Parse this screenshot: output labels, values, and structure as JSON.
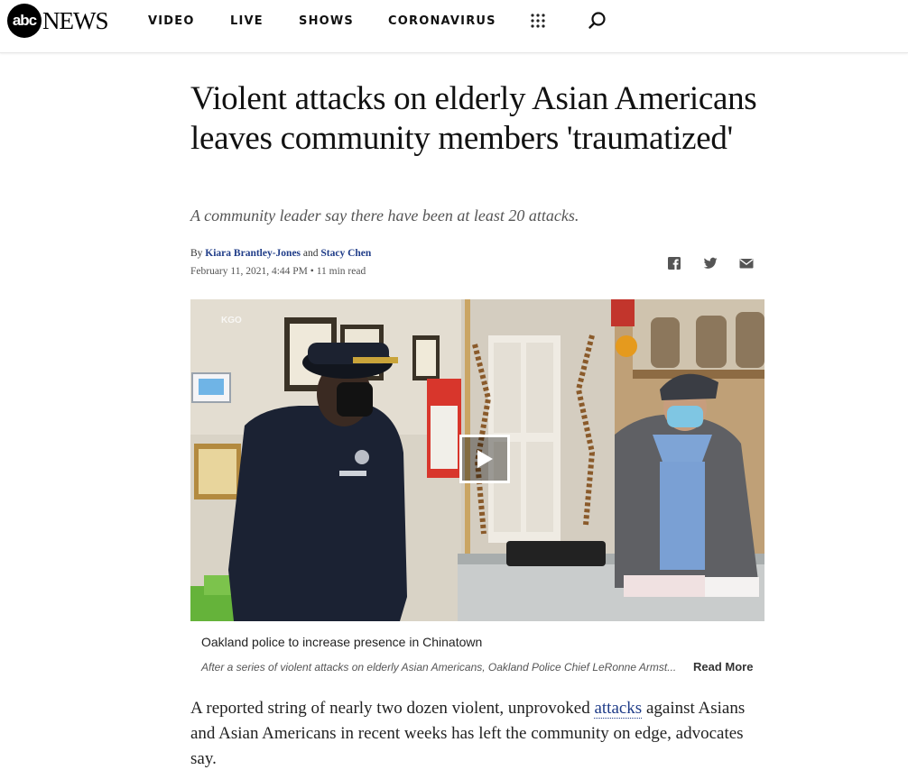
{
  "header": {
    "logo_mark": "abc",
    "logo_text": "NEWS",
    "nav": [
      {
        "label": "VIDEO"
      },
      {
        "label": "LIVE"
      },
      {
        "label": "SHOWS"
      },
      {
        "label": "CORONAVIRUS"
      }
    ],
    "icons": [
      "grid-menu-icon",
      "search-icon"
    ]
  },
  "article": {
    "headline": "Violent attacks on elderly Asian Americans leaves community members 'traumatized'",
    "subheadline": "A community leader say there have been at least 20 attacks.",
    "byline": {
      "prefix": "By",
      "author1": "Kiara Brantley-Jones",
      "conjunction": "and",
      "author2": "Stacy Chen"
    },
    "date": "February 11, 2021, 4:44 PM",
    "separator": "•",
    "read_time": "11 min read",
    "share_icons": [
      "facebook-icon",
      "twitter-icon",
      "email-icon"
    ],
    "video": {
      "watermark": "KGO",
      "caption_title": "Oakland police to increase presence in Chinatown",
      "caption_desc": "After a series of violent attacks on elderly Asian Americans, Oakland Police Chief LeRonne Armst...",
      "read_more": "Read More"
    },
    "body": {
      "before_link": "A reported string of nearly two dozen violent, unprovoked ",
      "link": "attacks",
      "after_link": " against Asians and Asian Americans in recent weeks has left the community on edge, advocates say."
    }
  },
  "colors": {
    "link": "#1f3c88",
    "text": "#111111",
    "muted": "#555555"
  }
}
